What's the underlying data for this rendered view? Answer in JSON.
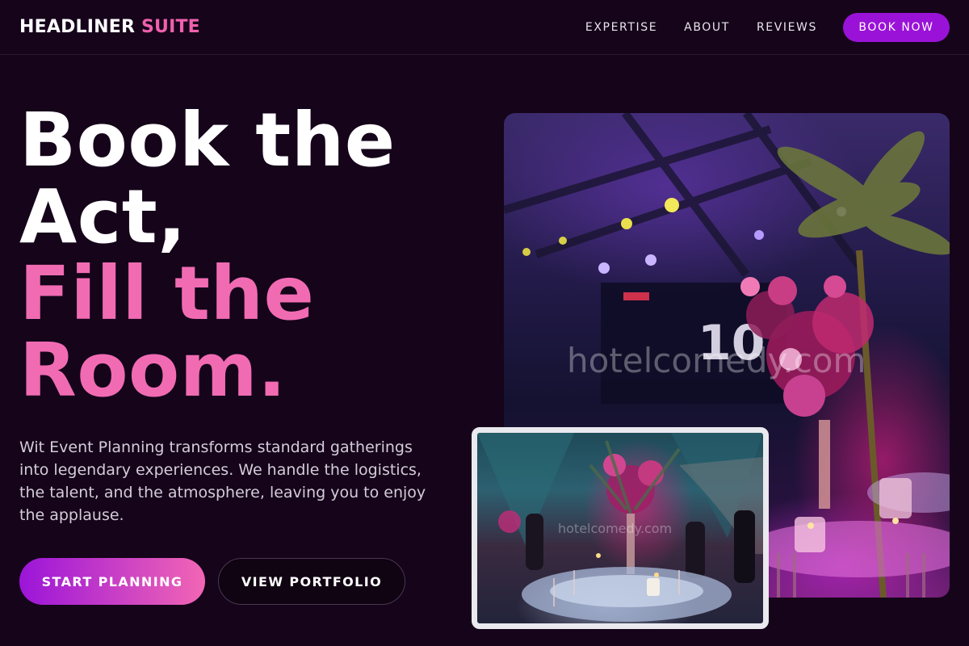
{
  "nav": {
    "brand_main": "HEADLINER",
    "brand_accent": "SUITE",
    "links": [
      "EXPERTISE",
      "ABOUT",
      "REVIEWS"
    ],
    "book_label": "BOOK NOW"
  },
  "hero": {
    "headline_lines": [
      "Book the",
      "Act,",
      "Fill the",
      "Room."
    ],
    "description": "Wit Event Planning transforms standard gatherings into legendary experiences. We handle the logistics, the talent, and the atmosphere, leaving you to enjoy the applause.",
    "primary_cta": "START PLANNING",
    "secondary_cta": "VIEW PORTFOLIO"
  },
  "images": {
    "main_watermark": "hotelcomedy.com",
    "inset_watermark": "hotelcomedy.com"
  },
  "colors": {
    "background": "#15041a",
    "accent_pink": "#f06bb3",
    "accent_purple": "#9a12d8"
  }
}
